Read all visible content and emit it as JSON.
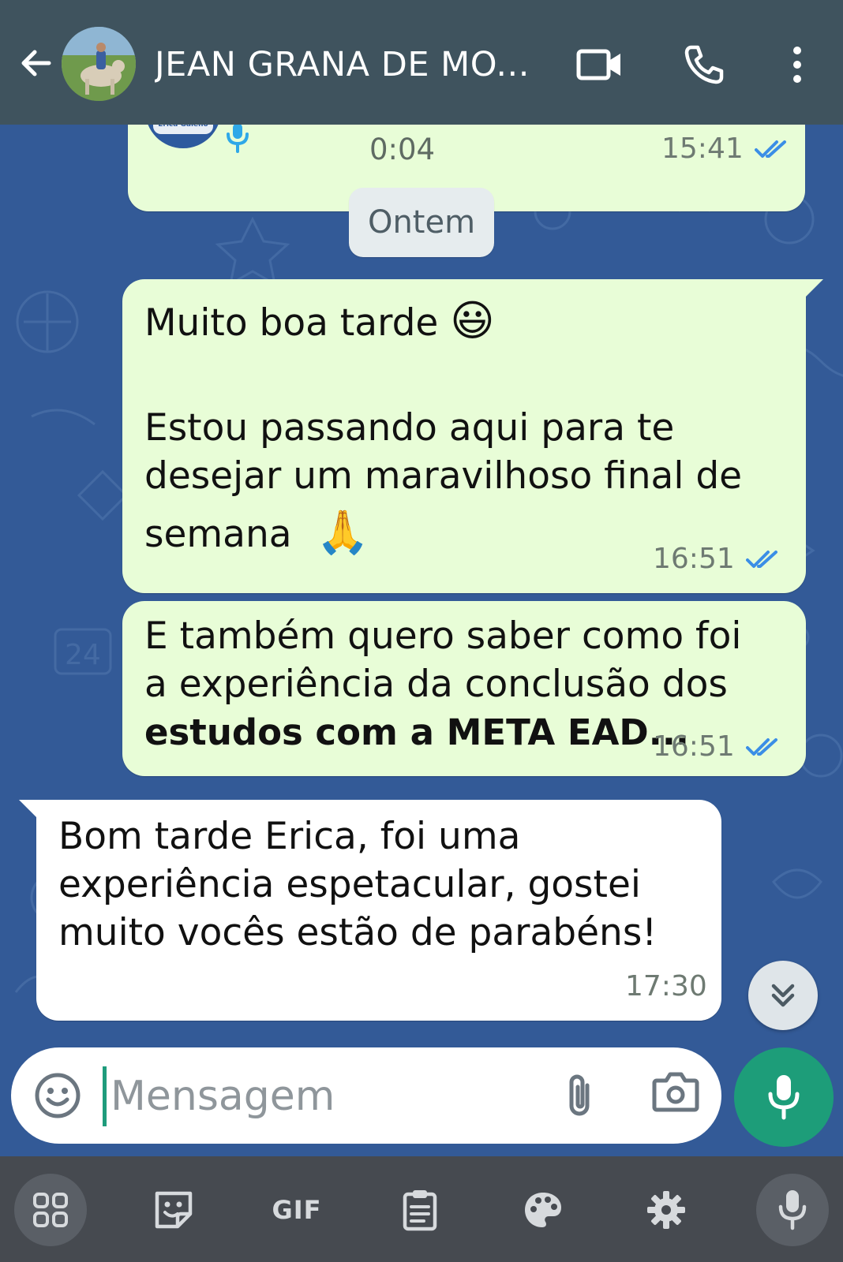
{
  "header": {
    "contact_name": "JEAN GRANA DE MO...",
    "back_icon": "arrow-left-icon",
    "video_icon": "video-camera-icon",
    "call_icon": "phone-icon",
    "menu_icon": "more-vertical-icon"
  },
  "chat": {
    "audio_message": {
      "duration": "0:04",
      "time": "15:41",
      "avatar_text": "Erica Galeno",
      "status": "read"
    },
    "date_divider": "Ontem",
    "messages": [
      {
        "direction": "outgoing",
        "line1": "Muito boa tarde",
        "emoji1": "😃",
        "line2": "Estou passando aqui para te",
        "line3": "desejar um maravilhoso final de",
        "line4": "semana",
        "emoji2": "🙏",
        "time": "16:51",
        "status": "read"
      },
      {
        "direction": "outgoing",
        "line1": "E também quero saber como foi",
        "line2": "a experiência da conclusão dos",
        "line3_bold": "estudos com a META EAD...",
        "time": "16:51",
        "status": "read"
      },
      {
        "direction": "incoming",
        "line1": "Bom tarde Erica, foi uma",
        "line2": "experiência espetacular, gostei",
        "line3": "muito vocês estão de parabéns!",
        "time": "17:30"
      }
    ]
  },
  "composer": {
    "placeholder": "Mensagem",
    "emoji_icon": "emoji-icon",
    "attach_icon": "paperclip-icon",
    "camera_icon": "camera-icon",
    "mic_icon": "microphone-icon"
  },
  "keyboard_toolbar": {
    "gif_label": "GIF",
    "items": [
      "apps-grid-icon",
      "sticker-icon",
      "gif-button",
      "clipboard-icon",
      "palette-icon",
      "settings-icon",
      "microphone-icon"
    ]
  },
  "colors": {
    "header_bg": "#3f535e",
    "wallpaper": "#335a97",
    "outgoing_bubble": "#e8fdd7",
    "incoming_bubble": "#ffffff",
    "read_ticks": "#3b8ee6",
    "accent_green": "#1d9d79"
  }
}
